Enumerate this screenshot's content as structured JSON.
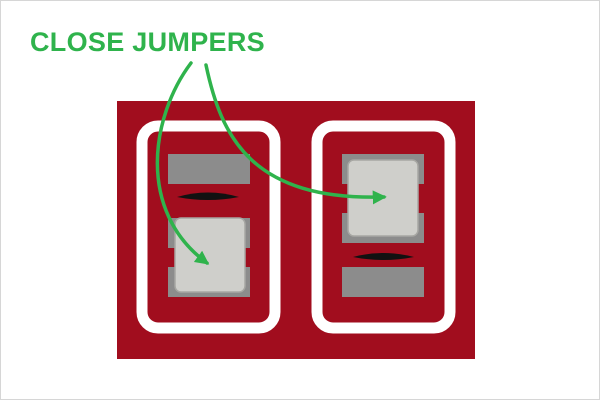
{
  "annotation": {
    "label": "CLOSE JUMPERS"
  },
  "colors": {
    "board": "#a10d1e",
    "outline": "#ffffff",
    "pad": "#8c8c8c",
    "jumper_cap": "#cfcfcb",
    "jumper_cap_border": "#a7a7a3",
    "arrow": "#2fb34c",
    "label": "#2fb34c",
    "background": "#ffffff",
    "frame_border": "#d6d6d6"
  },
  "jumpers": [
    {
      "name": "left-jumper",
      "state": "closed",
      "cap_position": "bottom"
    },
    {
      "name": "right-jumper",
      "state": "closed",
      "cap_position": "top"
    }
  ]
}
